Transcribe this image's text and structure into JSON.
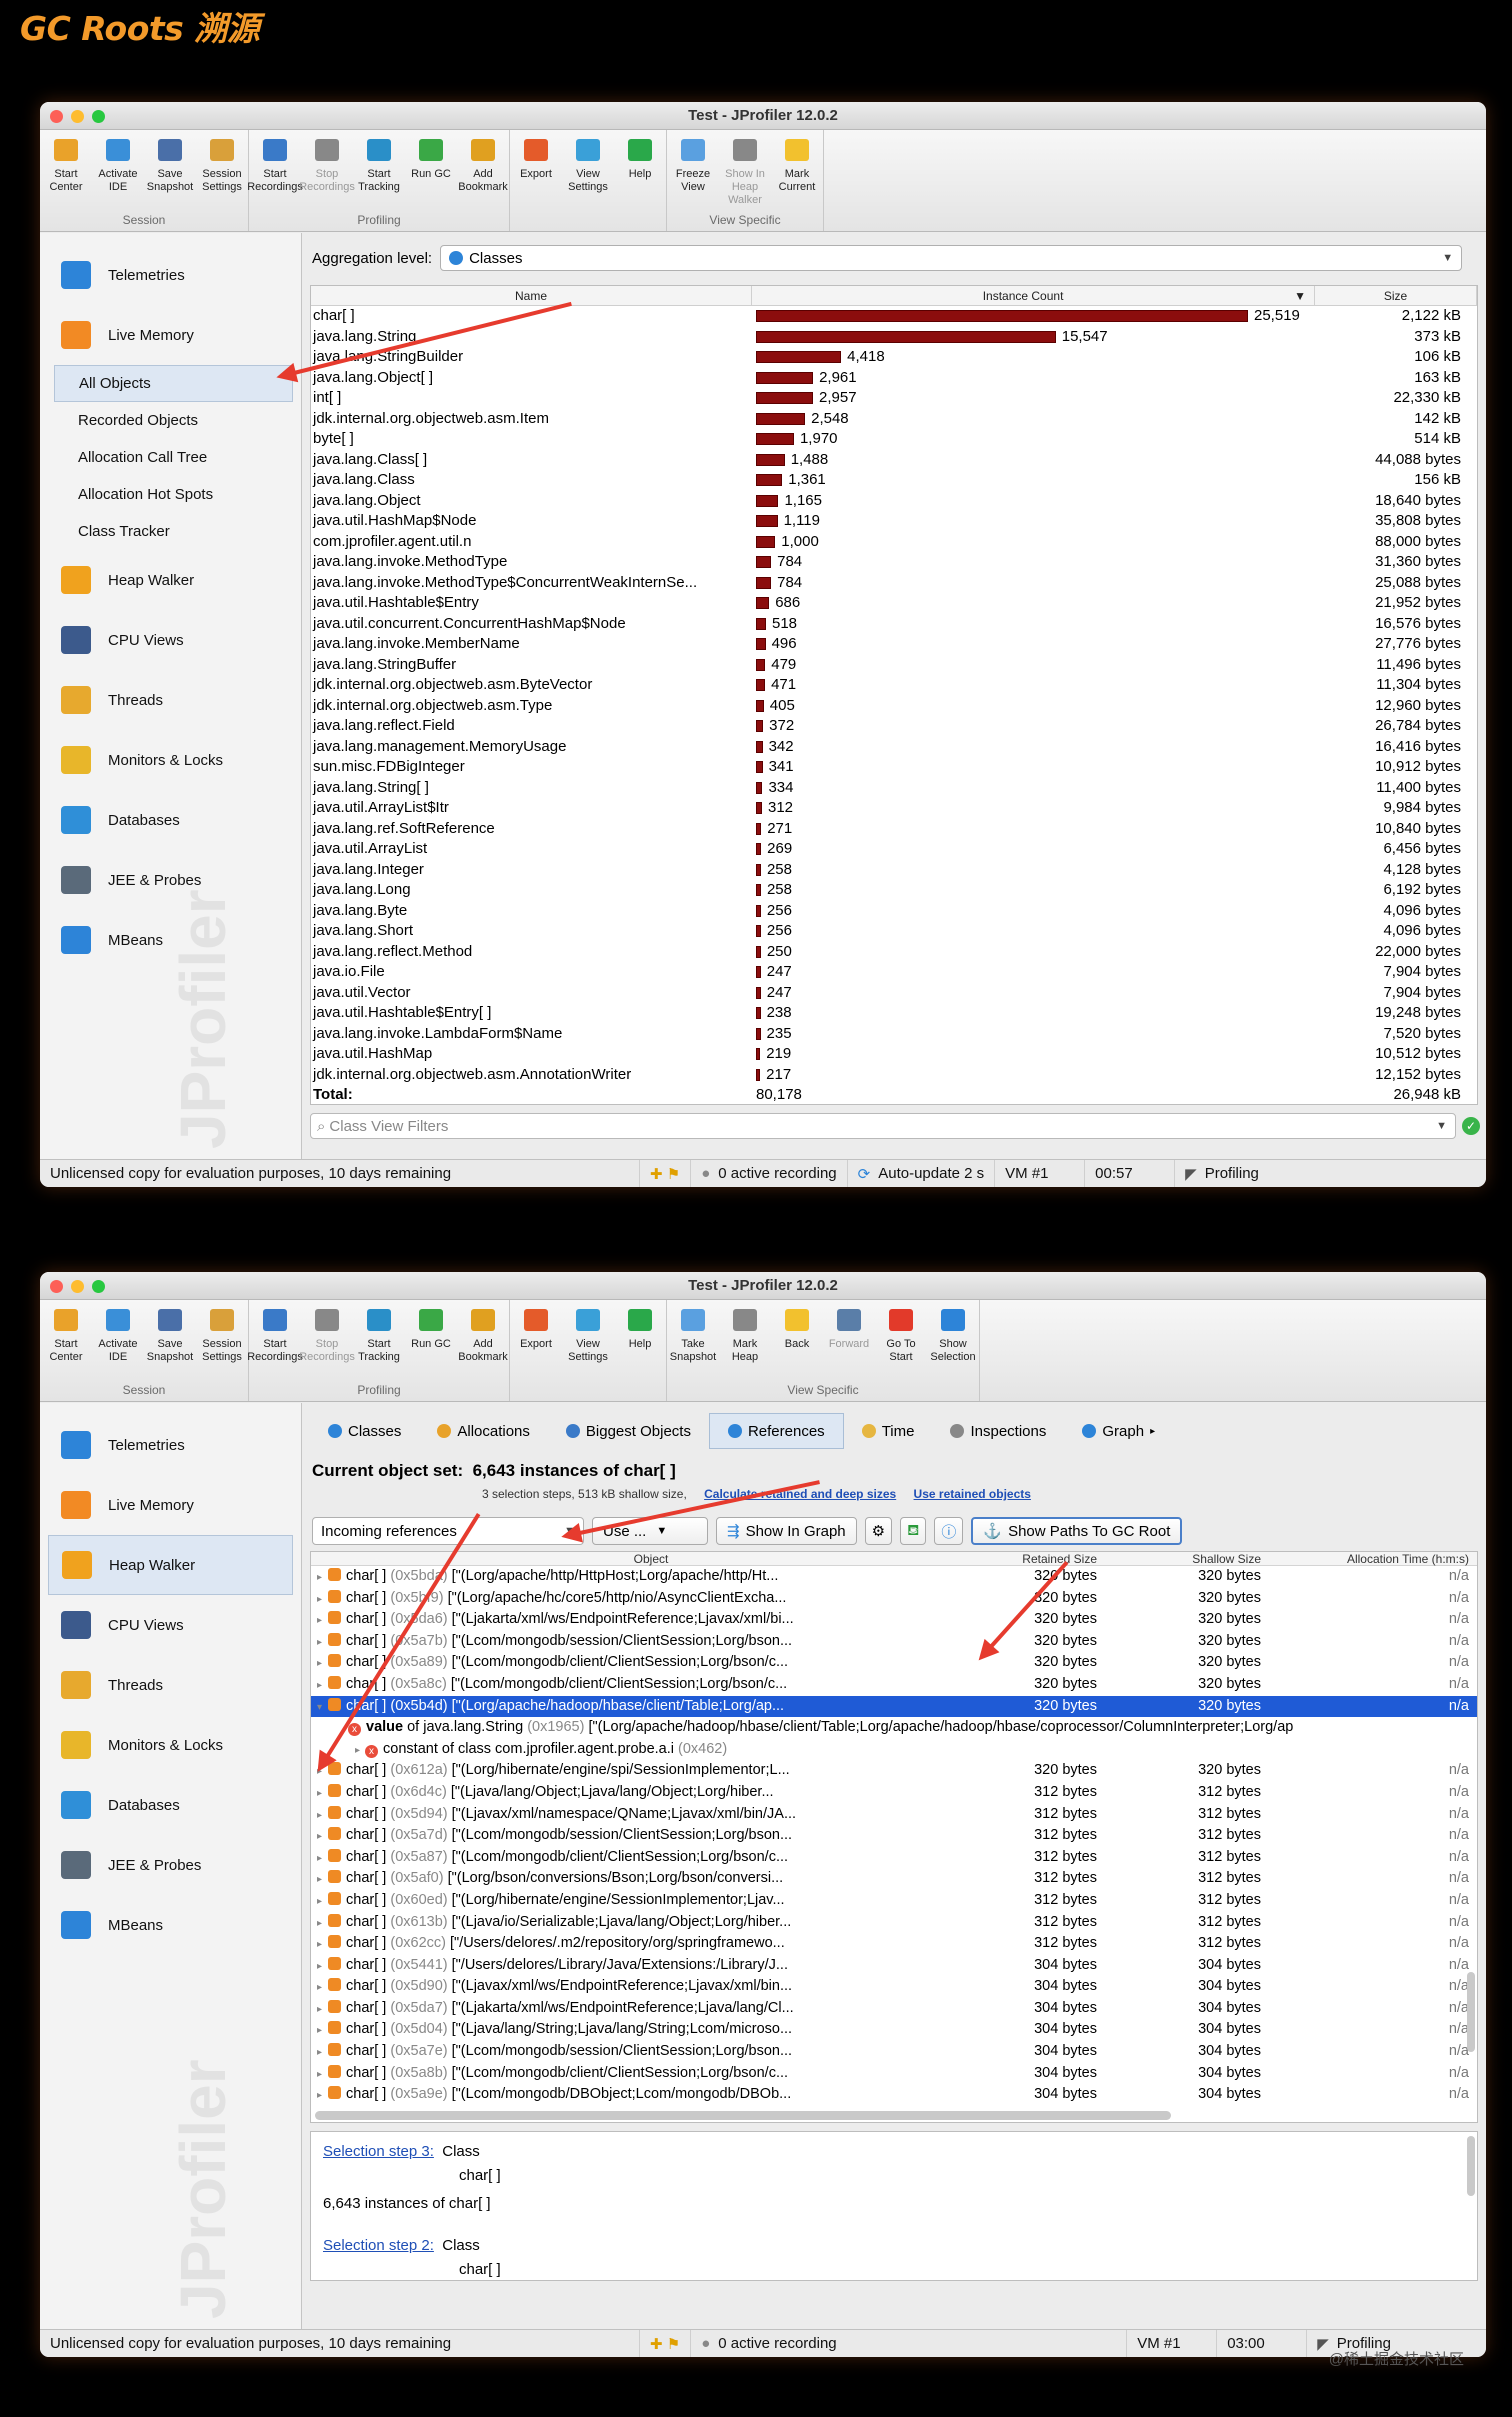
{
  "page": {
    "title": "GC Roots 溯源",
    "credit": "@稀土掘金技术社区"
  },
  "colors": {
    "accent_orange": "#f39a2a",
    "bar": "#8b0d0d",
    "selection": "#1f5bd6",
    "arrow": "#e63b2e"
  },
  "window_title": "Test - JProfiler 12.0.2",
  "toolbar1": {
    "groups": [
      {
        "label": "Session",
        "buttons": [
          [
            "Start",
            "Center"
          ],
          [
            "Activate",
            "IDE"
          ],
          [
            "Save",
            "Snapshot"
          ],
          [
            "Session",
            "Settings"
          ]
        ]
      },
      {
        "label": "Profiling",
        "buttons": [
          [
            "Start",
            "Recordings"
          ],
          [
            "Stop",
            "Recordings"
          ],
          [
            "Start",
            "Tracking"
          ],
          [
            "Run GC",
            ""
          ],
          [
            "Add",
            "Bookmark"
          ]
        ]
      },
      {
        "label": "",
        "buttons": [
          [
            "Export",
            ""
          ],
          [
            "View",
            "Settings"
          ],
          [
            "Help",
            ""
          ]
        ]
      },
      {
        "label": "View Specific",
        "buttons": [
          [
            "Freeze",
            "View"
          ],
          [
            "Show In",
            "Heap Walker"
          ],
          [
            "Mark",
            "Current"
          ]
        ]
      }
    ]
  },
  "toolbar2": {
    "groups": [
      {
        "label": "Session",
        "buttons": [
          [
            "Start",
            "Center"
          ],
          [
            "Activate",
            "IDE"
          ],
          [
            "Save",
            "Snapshot"
          ],
          [
            "Session",
            "Settings"
          ]
        ]
      },
      {
        "label": "Profiling",
        "buttons": [
          [
            "Start",
            "Recordings"
          ],
          [
            "Stop",
            "Recordings"
          ],
          [
            "Start",
            "Tracking"
          ],
          [
            "Run GC",
            ""
          ],
          [
            "Add",
            "Bookmark"
          ]
        ]
      },
      {
        "label": "",
        "buttons": [
          [
            "Export",
            ""
          ],
          [
            "View",
            "Settings"
          ],
          [
            "Help",
            ""
          ]
        ]
      },
      {
        "label": "View Specific",
        "buttons": [
          [
            "Take",
            "Snapshot"
          ],
          [
            "Mark",
            "Heap"
          ],
          [
            "Back",
            ""
          ],
          [
            "Forward",
            ""
          ],
          [
            "Go To",
            "Start"
          ],
          [
            "Show",
            "Selection"
          ]
        ]
      }
    ]
  },
  "sidebar": {
    "items": [
      "Telemetries",
      "Live Memory",
      "Heap Walker",
      "CPU Views",
      "Threads",
      "Monitors & Locks",
      "Databases",
      "JEE & Probes",
      "MBeans"
    ],
    "live_memory_sub": [
      "All Objects",
      "Recorded Objects",
      "Allocation Call Tree",
      "Allocation Hot Spots",
      "Class Tracker"
    ],
    "watermark": "JProfiler"
  },
  "win1": {
    "aggregation_label": "Aggregation level:",
    "aggregation_value": "Classes",
    "columns": [
      "Name",
      "Instance Count",
      "Size"
    ],
    "rows": [
      [
        "char[ ]",
        25519,
        "2,122 kB"
      ],
      [
        "java.lang.String",
        15547,
        "373 kB"
      ],
      [
        "java.lang.StringBuilder",
        4418,
        "106 kB"
      ],
      [
        "java.lang.Object[ ]",
        2961,
        "163 kB"
      ],
      [
        "int[ ]",
        2957,
        "22,330 kB"
      ],
      [
        "jdk.internal.org.objectweb.asm.Item",
        2548,
        "142 kB"
      ],
      [
        "byte[ ]",
        1970,
        "514 kB"
      ],
      [
        "java.lang.Class[ ]",
        1488,
        "44,088 bytes"
      ],
      [
        "java.lang.Class",
        1361,
        "156 kB"
      ],
      [
        "java.lang.Object",
        1165,
        "18,640 bytes"
      ],
      [
        "java.util.HashMap$Node",
        1119,
        "35,808 bytes"
      ],
      [
        "com.jprofiler.agent.util.n",
        1000,
        "88,000 bytes"
      ],
      [
        "java.lang.invoke.MethodType",
        784,
        "31,360 bytes"
      ],
      [
        "java.lang.invoke.MethodType$ConcurrentWeakInternSe...",
        784,
        "25,088 bytes"
      ],
      [
        "java.util.Hashtable$Entry",
        686,
        "21,952 bytes"
      ],
      [
        "java.util.concurrent.ConcurrentHashMap$Node",
        518,
        "16,576 bytes"
      ],
      [
        "java.lang.invoke.MemberName",
        496,
        "27,776 bytes"
      ],
      [
        "java.lang.StringBuffer",
        479,
        "11,496 bytes"
      ],
      [
        "jdk.internal.org.objectweb.asm.ByteVector",
        471,
        "11,304 bytes"
      ],
      [
        "jdk.internal.org.objectweb.asm.Type",
        405,
        "12,960 bytes"
      ],
      [
        "java.lang.reflect.Field",
        372,
        "26,784 bytes"
      ],
      [
        "java.lang.management.MemoryUsage",
        342,
        "16,416 bytes"
      ],
      [
        "sun.misc.FDBigInteger",
        341,
        "10,912 bytes"
      ],
      [
        "java.lang.String[ ]",
        334,
        "11,400 bytes"
      ],
      [
        "java.util.ArrayList$Itr",
        312,
        "9,984 bytes"
      ],
      [
        "java.lang.ref.SoftReference",
        271,
        "10,840 bytes"
      ],
      [
        "java.util.ArrayList",
        269,
        "6,456 bytes"
      ],
      [
        "java.lang.Integer",
        258,
        "4,128 bytes"
      ],
      [
        "java.lang.Long",
        258,
        "6,192 bytes"
      ],
      [
        "java.lang.Byte",
        256,
        "4,096 bytes"
      ],
      [
        "java.lang.Short",
        256,
        "4,096 bytes"
      ],
      [
        "java.lang.reflect.Method",
        250,
        "22,000 bytes"
      ],
      [
        "java.io.File",
        247,
        "7,904 bytes"
      ],
      [
        "java.util.Vector",
        247,
        "7,904 bytes"
      ],
      [
        "java.util.Hashtable$Entry[ ]",
        238,
        "19,248 bytes"
      ],
      [
        "java.lang.invoke.LambdaForm$Name",
        235,
        "7,520 bytes"
      ],
      [
        "java.util.HashMap",
        219,
        "10,512 bytes"
      ],
      [
        "jdk.internal.org.objectweb.asm.AnnotationWriter",
        217,
        "12,152 bytes"
      ]
    ],
    "total": {
      "label": "Total:",
      "count": "80,178",
      "size": "26,948 kB"
    },
    "filter_placeholder": "Class View Filters",
    "status": {
      "license": "Unlicensed copy for evaluation purposes, 10 days remaining",
      "recording": "0 active recording",
      "autoupdate": "Auto-update 2 s",
      "vm": "VM #1",
      "time": "00:57",
      "mode": "Profiling"
    }
  },
  "win2": {
    "tabs": [
      "Classes",
      "Allocations",
      "Biggest Objects",
      "References",
      "Time",
      "Inspections",
      "Graph"
    ],
    "current_label": "Current object set:",
    "current_value": "6,643 instances of char[ ]",
    "sub": "3 selection steps, 513 kB shallow size,",
    "link1": "Calculate retained and deep sizes",
    "link2": "Use retained objects",
    "ref_select": "Incoming references",
    "use_btn": "Use ...",
    "graph_btn": "Show In Graph",
    "gc_btn": "Show Paths To GC Root",
    "columns": [
      "Object",
      "Retained Size",
      "Shallow Size",
      "Allocation Time (h:m:s)"
    ],
    "rows": [
      [
        "char[ ]",
        "(0x5bda)",
        "[\"(Lorg/apache/http/HttpHost;Lorg/apache/http/Ht...",
        "320 bytes",
        "320 bytes"
      ],
      [
        "char[ ]",
        "(0x5bf9)",
        "[\"(Lorg/apache/hc/core5/http/nio/AsyncClientExcha...",
        "320 bytes",
        "320 bytes"
      ],
      [
        "char[ ]",
        "(0x5da6)",
        "[\"(Ljakarta/xml/ws/EndpointReference;Ljavax/xml/bi...",
        "320 bytes",
        "320 bytes"
      ],
      [
        "char[ ]",
        "(0x5a7b)",
        "[\"(Lcom/mongodb/session/ClientSession;Lorg/bson...",
        "320 bytes",
        "320 bytes"
      ],
      [
        "char[ ]",
        "(0x5a89)",
        "[\"(Lcom/mongodb/client/ClientSession;Lorg/bson/c...",
        "320 bytes",
        "320 bytes"
      ],
      [
        "char[ ]",
        "(0x5a8c)",
        "[\"(Lcom/mongodb/client/ClientSession;Lorg/bson/c...",
        "320 bytes",
        "320 bytes"
      ],
      [
        "char[ ]",
        "(0x5b4d)",
        "[\"(Lorg/apache/hadoop/hbase/client/Table;Lorg/ap...",
        "320 bytes",
        "320 bytes"
      ]
    ],
    "expanded1": {
      "field": "value",
      "of": "of java.lang.String",
      "id": "(0x1965)",
      "text": "[\"(Lorg/apache/hadoop/hbase/client/Table;Lorg/apache/hadoop/hbase/coprocessor/ColumnInterpreter;Lorg/ap"
    },
    "expanded2": {
      "text": "constant of class com.jprofiler.agent.probe.a.i",
      "id": "(0x462)"
    },
    "rows2": [
      [
        "char[ ]",
        "(0x612a)",
        "[\"(Lorg/hibernate/engine/spi/SessionImplementor;L...",
        "320 bytes",
        "320 bytes"
      ],
      [
        "char[ ]",
        "(0x6d4c)",
        "[\"(Ljava/lang/Object;Ljava/lang/Object;Lorg/hiber...",
        "312 bytes",
        "312 bytes"
      ],
      [
        "char[ ]",
        "(0x5d94)",
        "[\"(Ljavax/xml/namespace/QName;Ljavax/xml/bin/JA...",
        "312 bytes",
        "312 bytes"
      ],
      [
        "char[ ]",
        "(0x5a7d)",
        "[\"(Lcom/mongodb/session/ClientSession;Lorg/bson...",
        "312 bytes",
        "312 bytes"
      ],
      [
        "char[ ]",
        "(0x5a87)",
        "[\"(Lcom/mongodb/client/ClientSession;Lorg/bson/c...",
        "312 bytes",
        "312 bytes"
      ],
      [
        "char[ ]",
        "(0x5af0)",
        "[\"(Lorg/bson/conversions/Bson;Lorg/bson/conversi...",
        "312 bytes",
        "312 bytes"
      ],
      [
        "char[ ]",
        "(0x60ed)",
        "[\"(Lorg/hibernate/engine/SessionImplementor;Ljav...",
        "312 bytes",
        "312 bytes"
      ],
      [
        "char[ ]",
        "(0x613b)",
        "[\"(Ljava/io/Serializable;Ljava/lang/Object;Lorg/hiber...",
        "312 bytes",
        "312 bytes"
      ],
      [
        "char[ ]",
        "(0x62cc)",
        "[\"/Users/delores/.m2/repository/org/springframewo...",
        "312 bytes",
        "312 bytes"
      ],
      [
        "char[ ]",
        "(0x5441)",
        "[\"/Users/delores/Library/Java/Extensions:/Library/J...",
        "304 bytes",
        "304 bytes"
      ],
      [
        "char[ ]",
        "(0x5d90)",
        "[\"(Ljavax/xml/ws/EndpointReference;Ljavax/xml/bin...",
        "304 bytes",
        "304 bytes"
      ],
      [
        "char[ ]",
        "(0x5da7)",
        "[\"(Ljakarta/xml/ws/EndpointReference;Ljava/lang/Cl...",
        "304 bytes",
        "304 bytes"
      ],
      [
        "char[ ]",
        "(0x5d04)",
        "[\"(Ljava/lang/String;Ljava/lang/String;Lcom/microso...",
        "304 bytes",
        "304 bytes"
      ],
      [
        "char[ ]",
        "(0x5a7e)",
        "[\"(Lcom/mongodb/session/ClientSession;Lorg/bson...",
        "304 bytes",
        "304 bytes"
      ],
      [
        "char[ ]",
        "(0x5a8b)",
        "[\"(Lcom/mongodb/client/ClientSession;Lorg/bson/c...",
        "304 bytes",
        "304 bytes"
      ],
      [
        "char[ ]",
        "(0x5a9e)",
        "[\"(Lcom/mongodb/DBObject;Lcom/mongodb/DBOb...",
        "304 bytes",
        "304 bytes"
      ]
    ],
    "na": "n/a",
    "steps": {
      "s3_link": "Selection step 3:",
      "s3_kind": "Class",
      "s3_class": "char[ ]",
      "s3_count": "6,643 instances of char[ ]",
      "s2_link": "Selection step 2:",
      "s2_kind": "Class",
      "s2_class": "char[ ]"
    },
    "status": {
      "license": "Unlicensed copy for evaluation purposes, 10 days remaining",
      "recording": "0 active recording",
      "vm": "VM #1",
      "time": "03:00",
      "mode": "Profiling"
    }
  }
}
